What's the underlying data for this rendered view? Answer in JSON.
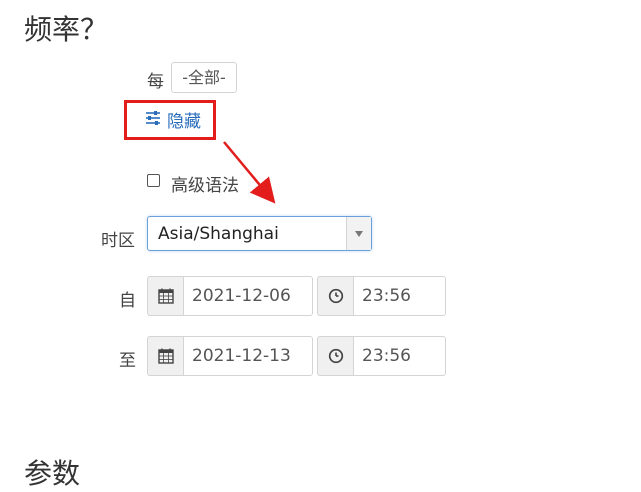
{
  "frequency": {
    "title": "频率？",
    "every_label": "每",
    "every_value": "-全部-"
  },
  "toggle": {
    "hide_label": "隐藏"
  },
  "advanced": {
    "label": "高级语法",
    "checked": false
  },
  "timezone": {
    "label": "时区",
    "value": "Asia/Shanghai"
  },
  "range": {
    "from_label": "自",
    "from_date": "2021-12-06",
    "from_time": "23:56",
    "to_label": "至",
    "to_date": "2021-12-13",
    "to_time": "23:56"
  },
  "params": {
    "title": "参数"
  },
  "colors": {
    "accent": "#2a6ebb",
    "annotation": "#e31c1c"
  }
}
